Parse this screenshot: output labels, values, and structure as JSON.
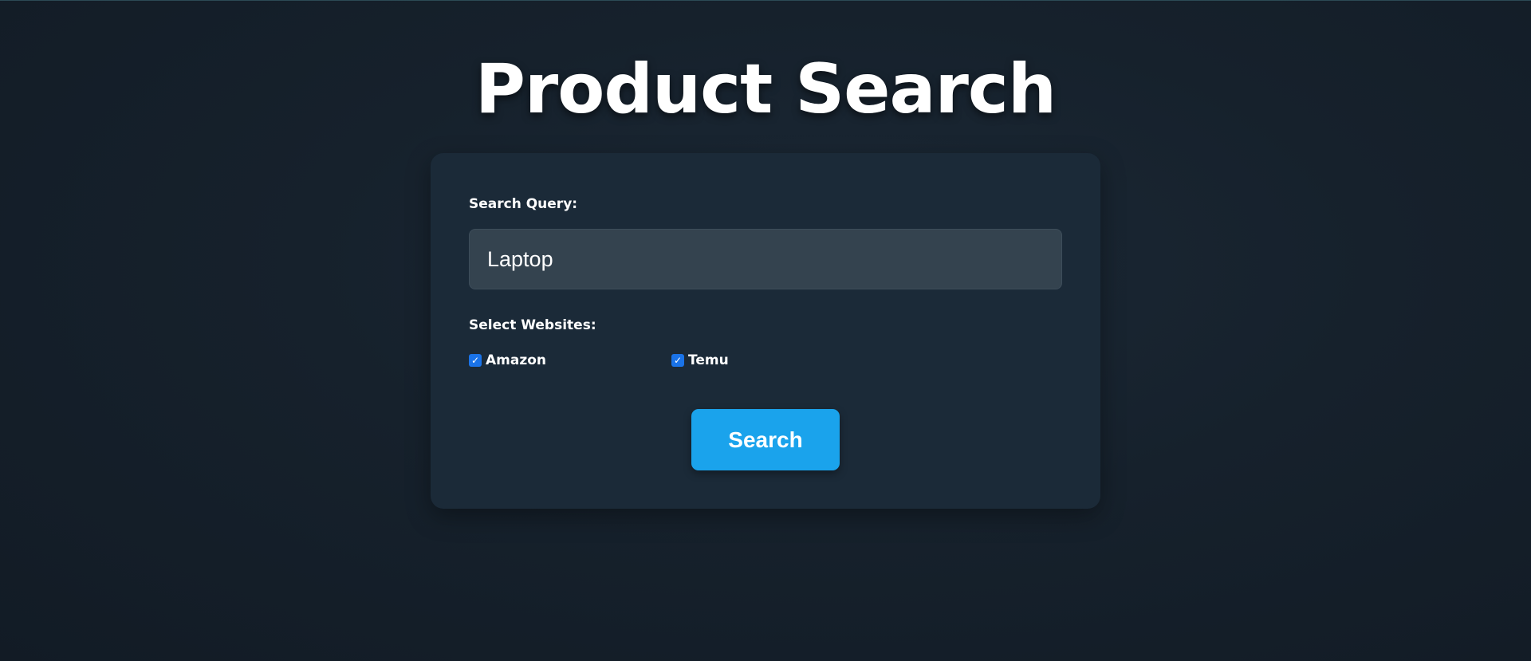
{
  "page": {
    "title": "Product Search"
  },
  "form": {
    "query_label": "Search Query:",
    "query_value": "Laptop",
    "websites_label": "Select Websites:",
    "websites": [
      {
        "label": "Amazon",
        "checked": true
      },
      {
        "label": "Temu",
        "checked": true
      }
    ],
    "submit_label": "Search"
  },
  "colors": {
    "accent": "#1aa3ec",
    "checkbox": "#1a73e8",
    "card_background": "#1b2a38",
    "input_background": "#34434f"
  },
  "icons": {
    "checkmark": "checkmark-icon"
  }
}
